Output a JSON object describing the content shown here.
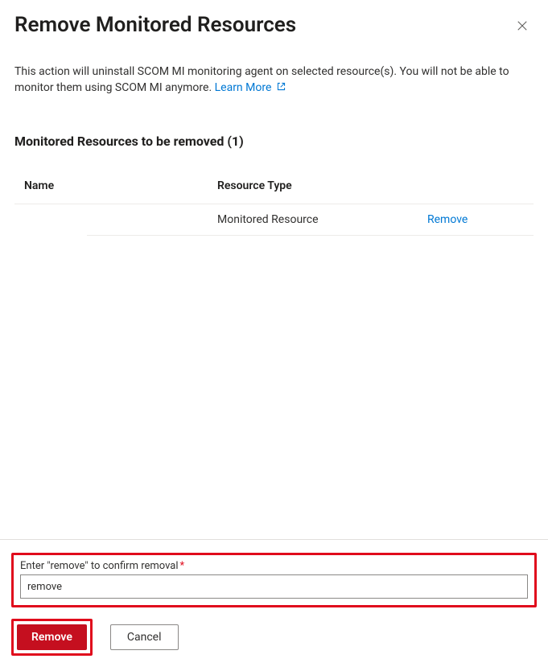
{
  "header": {
    "title": "Remove Monitored Resources"
  },
  "description": {
    "text": "This action will uninstall SCOM MI monitoring agent on selected resource(s). You will not be able to monitor them using SCOM MI anymore. ",
    "learn_more_label": "Learn More"
  },
  "section": {
    "title": "Monitored Resources to be removed (1)",
    "columns": {
      "name": "Name",
      "type": "Resource Type"
    },
    "rows": [
      {
        "name": "",
        "type": "Monitored Resource",
        "action_label": "Remove"
      }
    ]
  },
  "confirm": {
    "label": "Enter \"remove\" to confirm removal",
    "value": "remove"
  },
  "actions": {
    "primary": "Remove",
    "secondary": "Cancel"
  }
}
